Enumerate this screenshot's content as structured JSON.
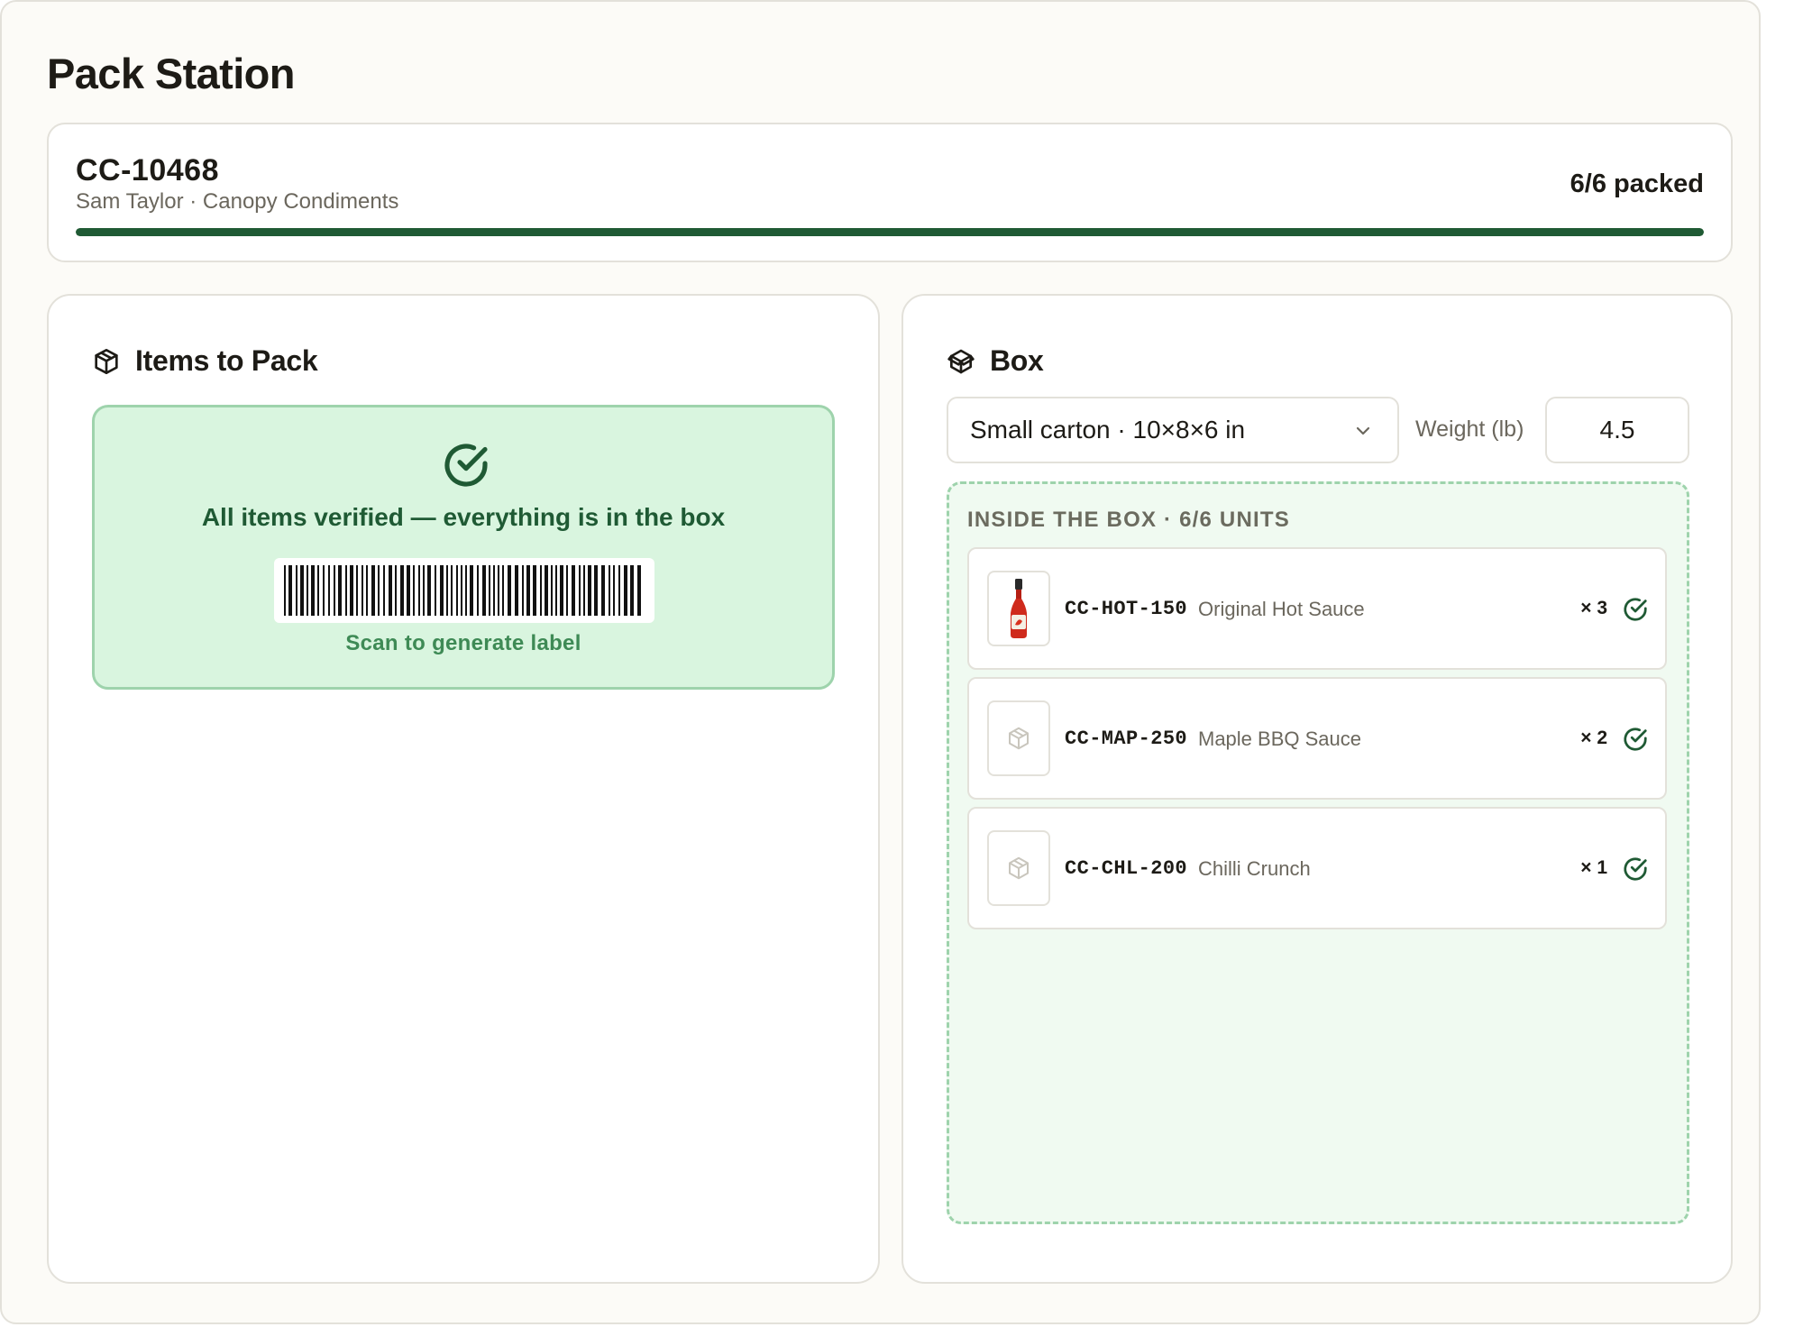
{
  "page": {
    "title": "Pack Station"
  },
  "order": {
    "id": "CC-10468",
    "subtitle": "Sam Taylor · Canopy Condiments",
    "status": "6/6 packed",
    "progress": 1.0,
    "accent": "#1f5a34"
  },
  "items_panel": {
    "heading": "Items to Pack",
    "icon": "package-icon",
    "verified_message": "All items verified — everything is in the box",
    "barcode_caption": "Scan to generate label"
  },
  "box_panel": {
    "heading": "Box",
    "icon": "boxes-icon",
    "box_type": "Small carton · 10×8×6 in",
    "weight_label": "Weight (lb)",
    "weight_value": "4.5",
    "contents_title": "INSIDE THE BOX · 6/6 UNITS",
    "items": [
      {
        "sku": "CC-HOT-150",
        "name": "Original Hot Sauce",
        "qty": "× 3",
        "thumb": "hot-sauce-bottle-image"
      },
      {
        "sku": "CC-MAP-250",
        "name": "Maple BBQ Sauce",
        "qty": "× 2",
        "thumb": "placeholder-box-icon"
      },
      {
        "sku": "CC-CHL-200",
        "name": "Chilli Crunch",
        "qty": "× 1",
        "thumb": "placeholder-box-icon"
      }
    ]
  },
  "colors": {
    "success_bg": "#d9f5df",
    "success_border": "#9ed3ac",
    "success_text": "#1f5a34",
    "page_bg": "#fcfbf7"
  }
}
